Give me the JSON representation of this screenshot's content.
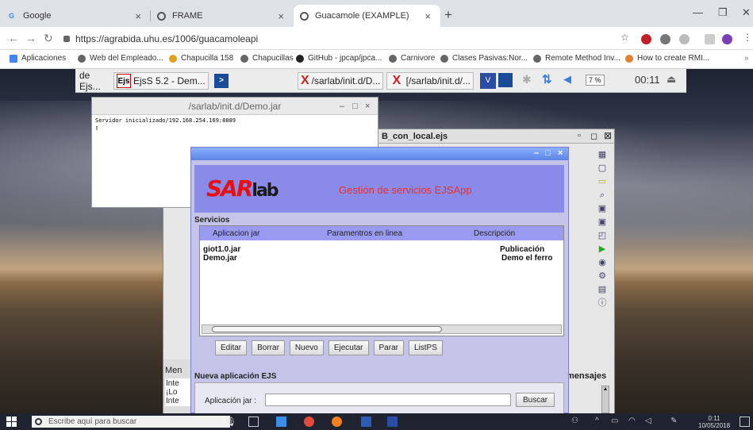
{
  "browser": {
    "tabs": [
      {
        "title": "Google",
        "icon": "google-icon"
      },
      {
        "title": "FRAME",
        "icon": "chrome-icon"
      },
      {
        "title": "Guacamole (EXAMPLE)",
        "icon": "chrome-icon"
      }
    ],
    "url": "https://agrabida.uhu.es/1006/guacamoleapi",
    "bookmarks": [
      "Aplicaciones",
      "Web del Empleado...",
      "Chapucilla 158",
      "Chapucillas",
      "GitHub - jpcap/jpca...",
      "Carnivore",
      "Clases Pasivas:Nor...",
      "Remote Method Inv...",
      "How to create RMI..."
    ]
  },
  "remote_panel": {
    "tasks": [
      "de Ejs...",
      "EjsS 5.2 - Dem...",
      "",
      "/sarlab/init.d/D...",
      "[/sarlab/init.d/..."
    ],
    "volume": "7 %",
    "clock": "00:11"
  },
  "terminal": {
    "title": "/sarlab/init.d/Demo.jar",
    "output": "Servidor inicializado/192.168.254.169:8889"
  },
  "ejs_window": {
    "title": "B_con_local.ejs",
    "left_panel_title": "Men",
    "left_panel_lines": [
      "Inte",
      "¡Lo",
      "Inte"
    ],
    "messages_label": "mensajes"
  },
  "sarlab": {
    "logo_text": "SAR",
    "logo_suffix": "lab",
    "header_title": "Gestión de servicios EJSApp",
    "services_label": "Servicios",
    "columns": [
      "Aplicacion jar",
      "Paramentros en linea",
      "Descripción"
    ],
    "rows": [
      {
        "jar": "giot1.0.jar",
        "desc": "Publicación"
      },
      {
        "jar": "Demo.jar",
        "desc": "Demo el ferro"
      }
    ],
    "buttons": [
      "Editar",
      "Borrar",
      "Nuevo",
      "Ejecutar",
      "Parar",
      "ListPS"
    ],
    "new_app_label": "Nueva aplicación EJS",
    "app_jar_label": "Aplicación jar :",
    "app_jar_value": "",
    "search_button": "Buscar"
  },
  "windows_taskbar": {
    "search_placeholder": "Escribe aquí para buscar",
    "time": "0:11",
    "date": "10/05/2018"
  }
}
